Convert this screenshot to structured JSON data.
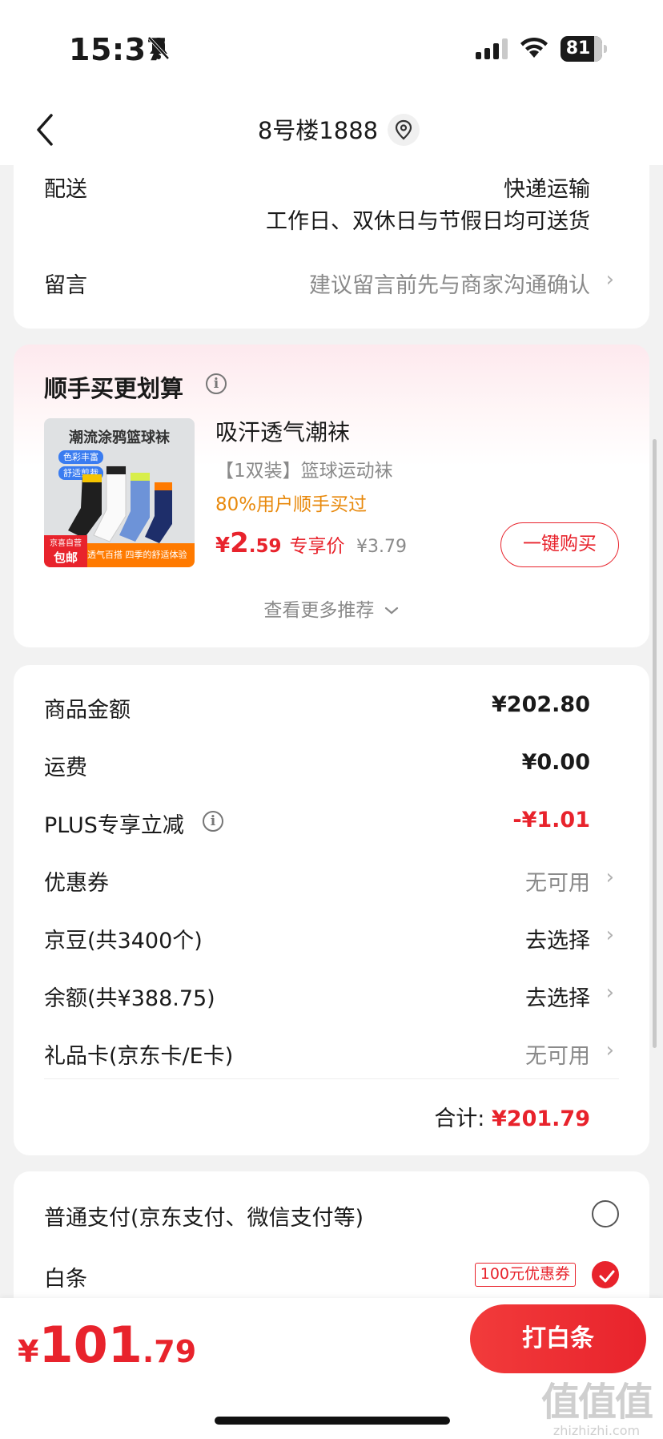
{
  "status_bar": {
    "time": "15:37",
    "battery": "81"
  },
  "nav": {
    "title": "8号楼1888"
  },
  "delivery": {
    "label": "配送",
    "method": "快递运输",
    "schedule": "工作日、双休日与节假日均可送货"
  },
  "message": {
    "label": "留言",
    "placeholder": "建议留言前先与商家沟通确认"
  },
  "recommend": {
    "title": "顺手买更划算",
    "product": {
      "image_title": "潮流涂鸦篮球袜",
      "image_tag1": "色彩丰富",
      "image_tag2": "舒适剪裁",
      "image_badge_small": "京喜自营",
      "image_badge": "包邮",
      "image_banner": "透气百搭 四季的舒适体验",
      "name": "吸汗透气潮袜",
      "spec": "【1双装】篮球运动袜",
      "stat": "80%用户顺手买过",
      "price_symbol": "¥",
      "price_int": "2",
      "price_dec": ".59",
      "price_tag": "专享价",
      "original_price": "¥3.79",
      "buy_label": "一键购买"
    },
    "more_label": "查看更多推荐"
  },
  "summary": {
    "rows": [
      {
        "label": "商品金额",
        "value": "¥202.80"
      },
      {
        "label": "运费",
        "value": "¥0.00"
      },
      {
        "label": "PLUS专享立减",
        "value": "-¥1.01"
      },
      {
        "label": "优惠券",
        "value": "无可用"
      },
      {
        "label": "京豆(共3400个)",
        "value": "去选择"
      },
      {
        "label": "余额(共¥388.75)",
        "value": "去选择"
      },
      {
        "label": "礼品卡(京东卡/E卡)",
        "value": "无可用"
      }
    ],
    "total_label": "合计:",
    "total_value": "¥201.79"
  },
  "payment": {
    "options": [
      {
        "label": "普通支付(京东支付、微信支付等)",
        "selected": false
      },
      {
        "label": "白条",
        "selected": true,
        "coupon": "100元优惠券"
      }
    ]
  },
  "bottom": {
    "price_symbol": "¥",
    "price_int": "101",
    "price_dec": ".79",
    "pay_label": "打白条",
    "watermark_main": "值值值",
    "watermark_sub": "zhizhizhi.com"
  },
  "colors": {
    "accent": "#e8232c",
    "highlight": "#e8890c",
    "muted": "#8a8a8a"
  }
}
